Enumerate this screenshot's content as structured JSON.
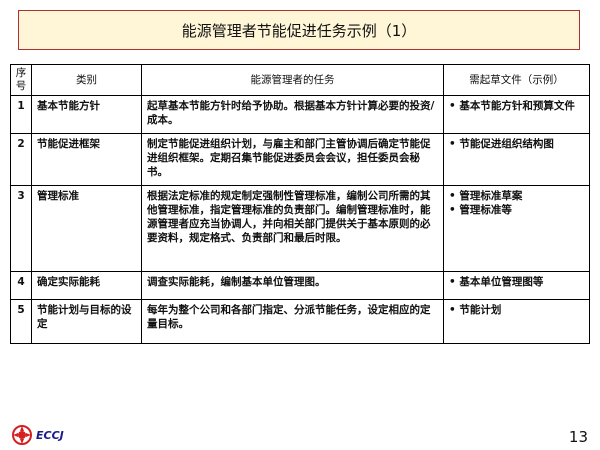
{
  "title": "能源管理者节能促进任务示例（1）",
  "table": {
    "headers": {
      "no": "序号",
      "category": "类别",
      "task": "能源管理者的任务",
      "docs": "需起草文件（示例）"
    },
    "rows": [
      {
        "no": "1",
        "category": "基本节能方针",
        "task": "起草基本节能方针时给予协助。根据基本方针计算必要的投资/成本。",
        "docs": [
          "基本节能方针和预算文件"
        ]
      },
      {
        "no": "2",
        "category": "节能促进框架",
        "task": "制定节能促进组织计划，与雇主和部门主管协调后确定节能促进组织框架。定期召集节能促进委员会会议，担任委员会秘书。",
        "docs": [
          "节能促进组织结构图"
        ]
      },
      {
        "no": "3",
        "category": "管理标准",
        "task": "根据法定标准的规定制定强制性管理标准，编制公司所需的其他管理标准，指定管理标准的负责部门。编制管理标准时，能源管理者应充当协调人，并向相关部门提供关于基本原则的必要资料，规定格式、负责部门和最后时限。",
        "docs": [
          "管理标准草案",
          "管理标准等"
        ]
      },
      {
        "no": "4",
        "category": "确定实际能耗",
        "task": "调查实际能耗，编制基本单位管理图。",
        "docs": [
          "基本单位管理图等"
        ]
      },
      {
        "no": "5",
        "category": "节能计划与目标的设定",
        "task": "每年为整个公司和各部门指定、分派节能任务，设定相应的定量目标。",
        "docs": [
          "节能计划"
        ]
      }
    ]
  },
  "footer": {
    "logo_text": "ECCJ",
    "page_number": "13"
  },
  "colors": {
    "title_bg": "#fff6d8",
    "title_border": "#b03030",
    "logo_red": "#d42020",
    "logo_text": "#1a1a8a"
  }
}
